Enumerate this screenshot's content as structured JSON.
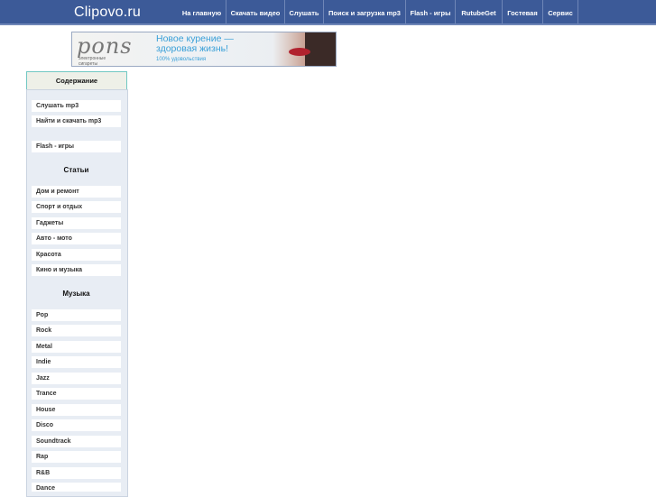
{
  "site": {
    "logo": "Clipovo.ru"
  },
  "nav": [
    {
      "label": "На главную"
    },
    {
      "label": "Скачать видео"
    },
    {
      "label": "Слушать"
    },
    {
      "label": "Поиск и загрузка mp3"
    },
    {
      "label": "Flash - игры"
    },
    {
      "label": "RutubeGet"
    },
    {
      "label": "Гостевая"
    },
    {
      "label": "Сервис"
    }
  ],
  "banner": {
    "brand": "pons",
    "brand_sub": "электронные сигареты",
    "headline_1": "Новое курение —",
    "headline_2": "здоровая жизнь!",
    "small": "100% удовольствия"
  },
  "sidebar": {
    "contents_label": "Содержание",
    "top_items": [
      {
        "label": "Слушать mp3"
      },
      {
        "label": "Найти и скачать mp3"
      },
      {
        "label": "Flash - игры"
      }
    ],
    "articles_heading": "Статьи",
    "articles": [
      {
        "label": "Дом и ремонт"
      },
      {
        "label": "Спорт и отдых"
      },
      {
        "label": "Гаджеты"
      },
      {
        "label": "Авто - мото"
      },
      {
        "label": "Красота"
      },
      {
        "label": "Кино и музыка"
      }
    ],
    "music_heading": "Музыка",
    "music": [
      {
        "label": "Pop"
      },
      {
        "label": "Rock"
      },
      {
        "label": "Metal"
      },
      {
        "label": "Indie"
      },
      {
        "label": "Jazz"
      },
      {
        "label": "Trance"
      },
      {
        "label": "House"
      },
      {
        "label": "Disco"
      },
      {
        "label": "Soundtrack"
      },
      {
        "label": "Rap"
      },
      {
        "label": "R&B"
      },
      {
        "label": "Dance"
      }
    ]
  }
}
